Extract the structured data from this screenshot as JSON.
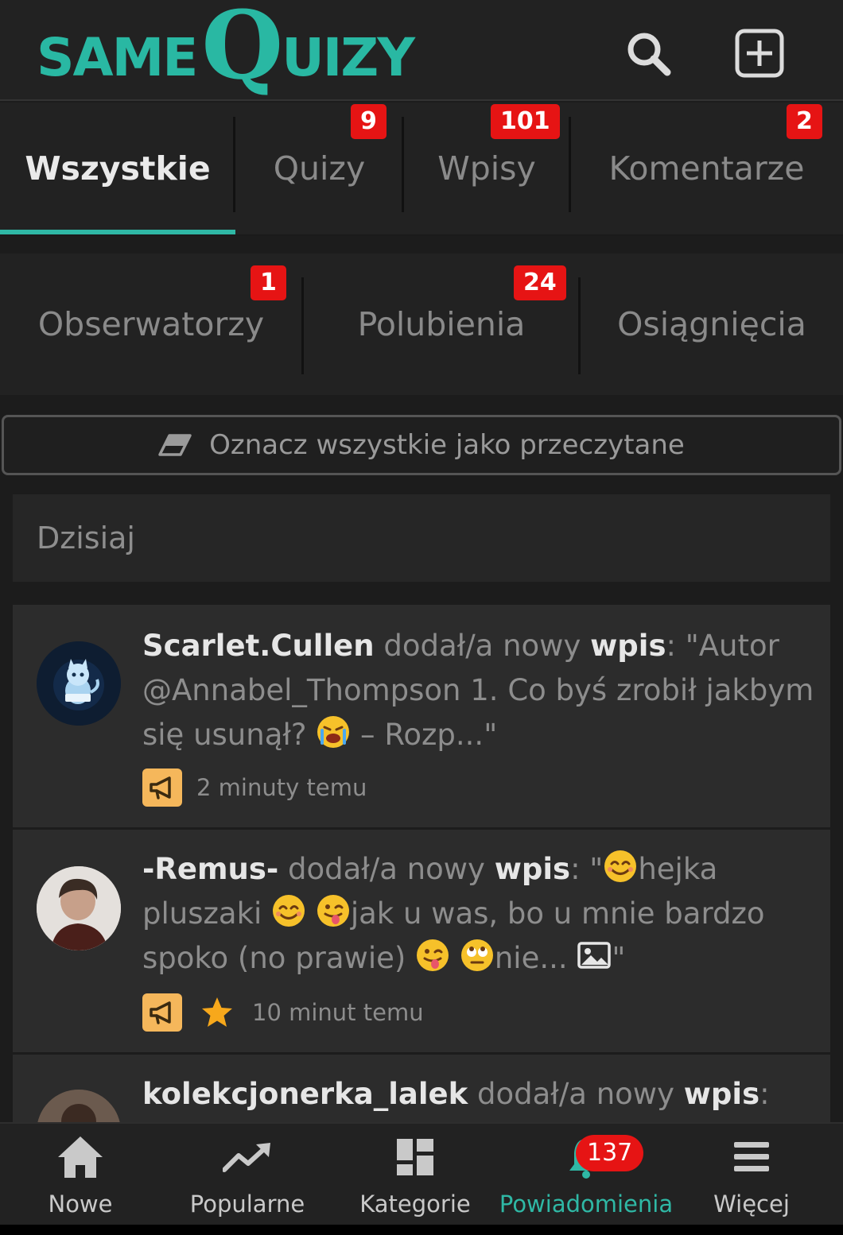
{
  "header": {
    "logo": {
      "part1": "SAME",
      "part2": "Q",
      "part3": "UIZY"
    }
  },
  "tabs": [
    {
      "label": "Wszystkie",
      "badge": ""
    },
    {
      "label": "Quizy",
      "badge": "9"
    },
    {
      "label": "Wpisy",
      "badge": "101"
    },
    {
      "label": "Komentarze",
      "badge": "2"
    }
  ],
  "tabs2": [
    {
      "label": "Obserwatorzy",
      "badge": "1"
    },
    {
      "label": "Polubienia",
      "badge": "24"
    },
    {
      "label": "Osiągnięcia",
      "badge": ""
    }
  ],
  "mark_read_label": "Oznacz wszystkie jako przeczytane",
  "section_title": "Dzisiaj",
  "notifications": [
    {
      "user": "Scarlet.Cullen",
      "action": "dodał/a nowy",
      "kind": "wpis",
      "text_a": ": \"Autor @Annabel_Thompson 1. Co byś zrobił jakbym się usunął? ",
      "text_b": " – Rozp...\"",
      "time": "2 minuty temu"
    },
    {
      "user": "-Remus-",
      "action": "dodał/a nowy",
      "kind": "wpis",
      "text_a": ": \"",
      "text_b": "hejka pluszaki ",
      "text_c": "jak u was, bo u mnie bardzo spoko (no prawie) ",
      "text_d": "nie... ",
      "text_e": "\"",
      "time": "10 minut temu"
    },
    {
      "user": "kolekcjonerka_lalek",
      "action": "dodał/a nowy",
      "kind": "wpis",
      "text_a": ":"
    }
  ],
  "bottom_nav": [
    {
      "label": "Nowe",
      "icon": "home-icon"
    },
    {
      "label": "Popularne",
      "icon": "trending-icon"
    },
    {
      "label": "Kategorie",
      "icon": "grid-icon"
    },
    {
      "label": "Powiadomienia",
      "icon": "bell-icon",
      "badge": "137"
    },
    {
      "label": "Więcej",
      "icon": "menu-icon"
    }
  ],
  "colors": {
    "accent": "#2fb8a5",
    "badge": "#e61414",
    "megaphone": "#f5b75b"
  }
}
